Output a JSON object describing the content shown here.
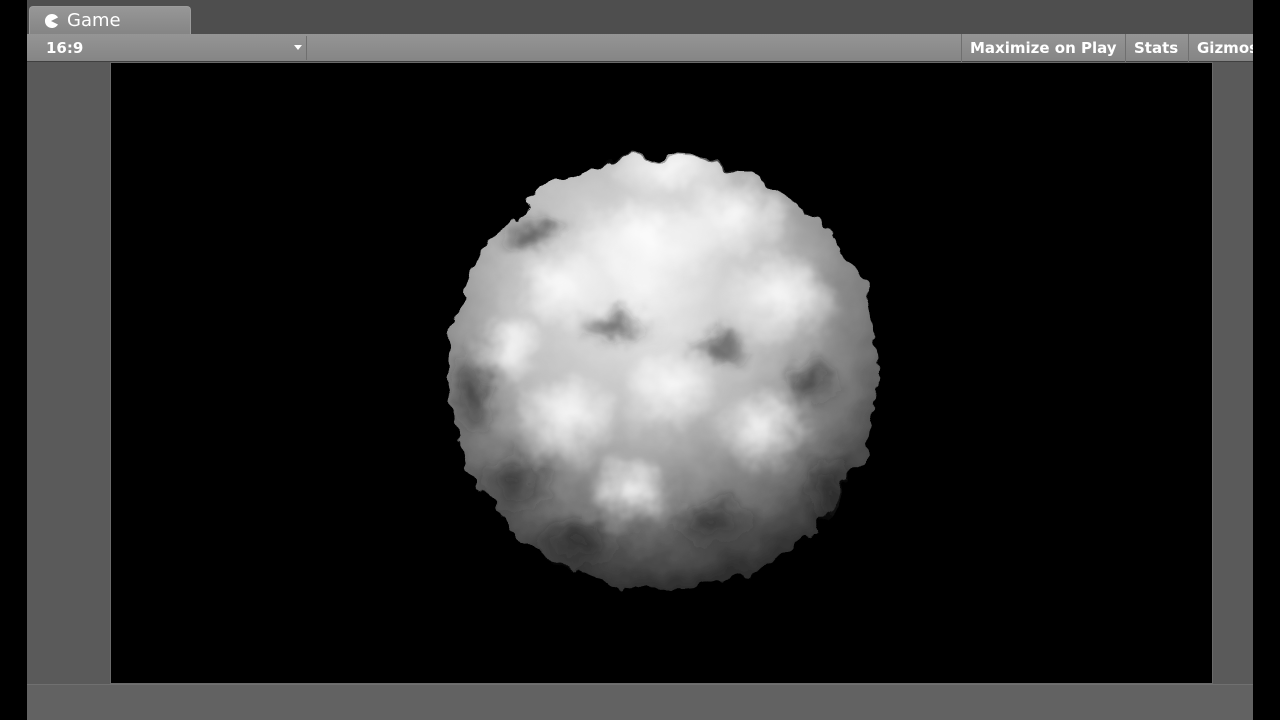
{
  "window": {
    "tab_label": "Game",
    "tab_icon": "pacman-icon"
  },
  "toolbar": {
    "aspect_ratio": "16:9",
    "maximize_label": "Maximize on Play",
    "stats_label": "Stats",
    "gizmos_label": "Gizmos"
  },
  "viewport": {
    "background_color": "#000000",
    "object": "noise-displaced-sphere"
  }
}
